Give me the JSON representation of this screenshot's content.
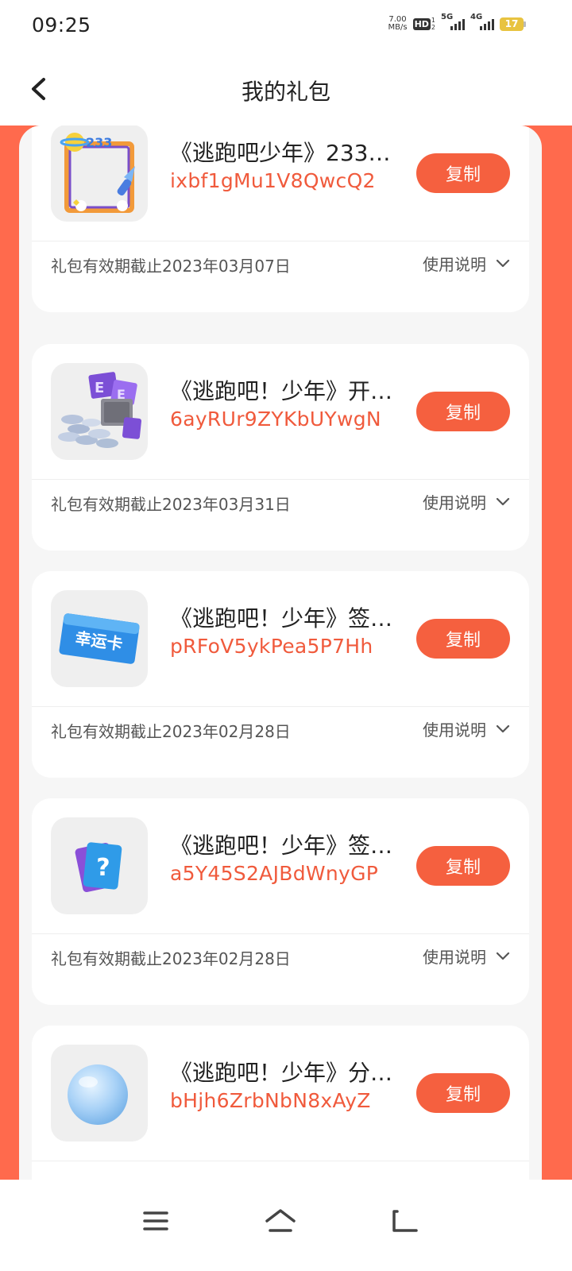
{
  "status_bar": {
    "time": "09:25",
    "net_speed_value": "7.00",
    "net_speed_unit": "MB/s",
    "hd_label": "HD",
    "hd_sub_1": "1",
    "hd_sub_2": "2",
    "signal_1_label": "5G",
    "signal_2_label": "4G",
    "battery_level": "17",
    "battery_color": "#e8c340"
  },
  "header": {
    "title": "我的礼包",
    "back_icon": "chevron-left-icon"
  },
  "colors": {
    "accent": "#f5603f",
    "code_text": "#f05a3c",
    "background_frame": "#ff6a4d"
  },
  "gifts": [
    {
      "title": "《逃跑吧少年》233…",
      "code": "ixbf1gMu1V8QwcQ2",
      "copy_label": "复制",
      "expiry": "礼包有效期截止2023年03月07日",
      "usage_label": "使用说明",
      "icon": "avatar-frame-icon"
    },
    {
      "title": "《逃跑吧！少年》开…",
      "code": "6ayRUr9ZYKbUYwgN",
      "copy_label": "复制",
      "expiry": "礼包有效期截止2023年03月31日",
      "usage_label": "使用说明",
      "icon": "coins-and-boxes-icon"
    },
    {
      "title": "《逃跑吧！少年》签…",
      "code": "pRFoV5ykPea5P7Hh",
      "copy_label": "复制",
      "expiry": "礼包有效期截止2023年02月28日",
      "usage_label": "使用说明",
      "icon": "lucky-card-icon",
      "icon_text": "幸运卡"
    },
    {
      "title": "《逃跑吧！少年》签…",
      "code": "a5Y45S2AJBdWnyGP",
      "copy_label": "复制",
      "expiry": "礼包有效期截止2023年02月28日",
      "usage_label": "使用说明",
      "icon": "mystery-card-icon",
      "icon_text": "?"
    },
    {
      "title": "《逃跑吧！少年》分…",
      "code": "bHjh6ZrbNbN8xAyZ",
      "copy_label": "复制",
      "expiry": "",
      "usage_label": "",
      "icon": "snowball-icon"
    }
  ],
  "bottom_nav": {
    "menu_icon": "menu-icon",
    "home_icon": "home-icon",
    "back_icon": "back-icon"
  }
}
